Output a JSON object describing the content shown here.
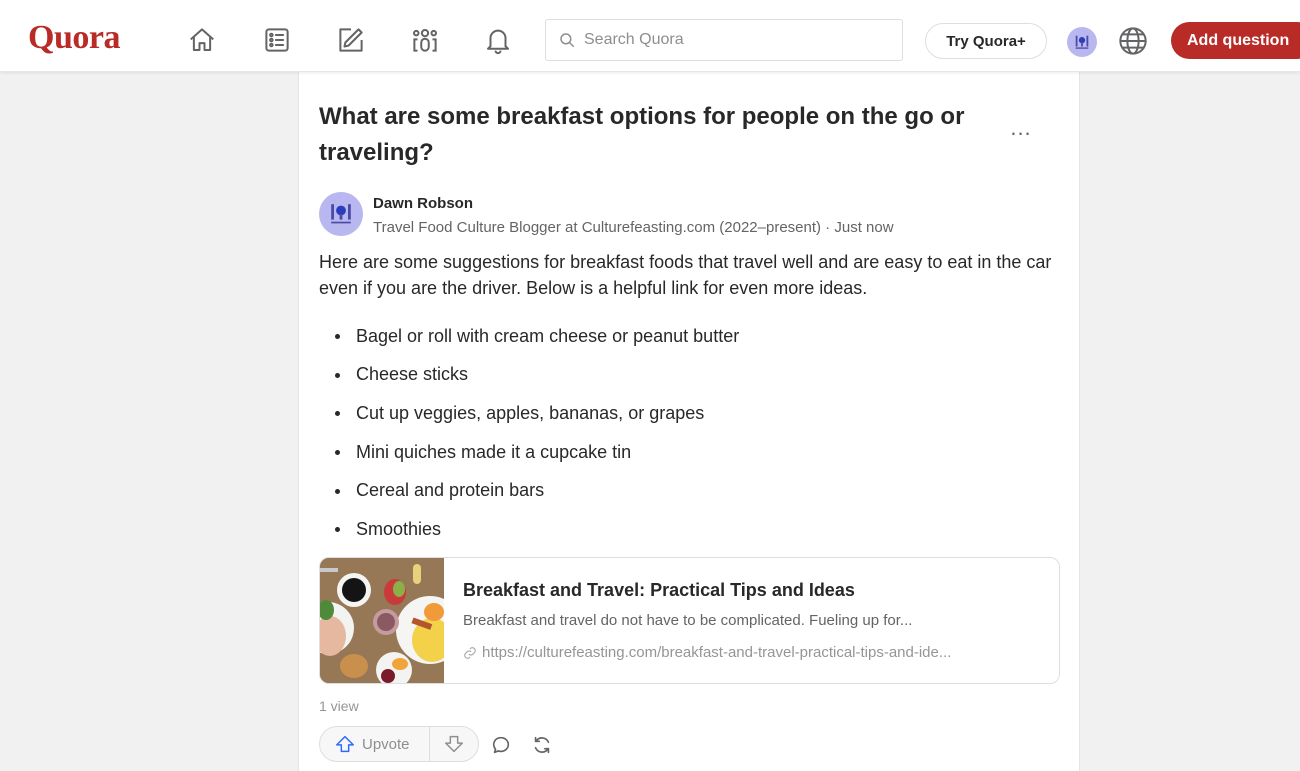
{
  "header": {
    "logo": "Quora",
    "nav": [
      {
        "name": "home",
        "icon": "home-icon"
      },
      {
        "name": "following",
        "icon": "list-icon"
      },
      {
        "name": "answer",
        "icon": "edit-icon"
      },
      {
        "name": "spaces",
        "icon": "people-icon"
      },
      {
        "name": "notifications",
        "icon": "bell-icon"
      }
    ],
    "search_placeholder": "Search Quora",
    "search_value": "",
    "try_button": "Try Quora+",
    "add_question_button": "Add question",
    "colors": {
      "brand": "#b92b27",
      "avatar_bg": "#b9b7f0"
    }
  },
  "question": {
    "title": "What are some breakfast options for people on the go or traveling?",
    "more_label": "..."
  },
  "answer": {
    "author": "Dawn Robson",
    "credential": "Travel Food Culture Blogger at Culturefeasting.com (2022–present)",
    "separator": " · ",
    "time": "Just now",
    "intro": "Here are some suggestions for breakfast foods that travel well and are easy to eat in the car even if you are the driver. Below is a helpful link for even more ideas.",
    "items": [
      "Bagel or roll with cream cheese or peanut butter",
      "Cheese sticks",
      "Cut up veggies, apples, bananas, or grapes",
      "Mini quiches made it a cupcake tin",
      "Cereal and protein bars",
      "Smoothies"
    ],
    "link_card": {
      "title": "Breakfast and Travel: Practical Tips and Ideas",
      "description": "Breakfast and travel do not have to be complicated. Fueling up for...",
      "url": "https://culturefeasting.com/breakfast-and-travel-practical-tips-and-ide..."
    },
    "views": "1 view",
    "upvote_label": "Upvote"
  }
}
